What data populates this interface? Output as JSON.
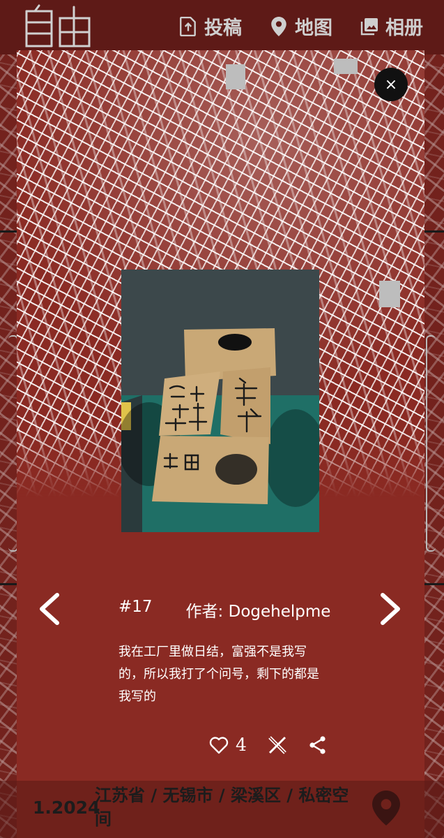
{
  "app": {
    "logo_text": "自由",
    "nav": [
      {
        "label": "投稿",
        "icon": "upload-file-icon"
      },
      {
        "label": "地图",
        "icon": "map-pin-icon"
      },
      {
        "label": "相册",
        "icon": "photo-album-icon"
      }
    ]
  },
  "modal": {
    "close_label": "×",
    "photo": {
      "subject": "cardboard box with handwritten protest slogans",
      "handwriting": [
        "狗",
        "狗狗币",
        "民主",
        "富强",
        "自由"
      ]
    },
    "post": {
      "number": "#17",
      "author_label": "作者: Dogehelpme",
      "description": "我在工厂里做日结，富强不是我写的，所以我打了个问号，剩下的都是我写的"
    },
    "actions": {
      "like_count": "4",
      "like_icon": "heart-icon",
      "share_x_icon": "x-logo-icon",
      "share_icon": "share-icon"
    }
  },
  "footer": {
    "date": "1.2024",
    "location": "江苏省 / 无锡市 / 梁溪区 / 私密空间",
    "pin_icon": "location-pin-icon"
  },
  "colors": {
    "brand_red": "#8a2a23",
    "topbar": "#5e1a17",
    "nav_text": "#cfcfcf"
  }
}
